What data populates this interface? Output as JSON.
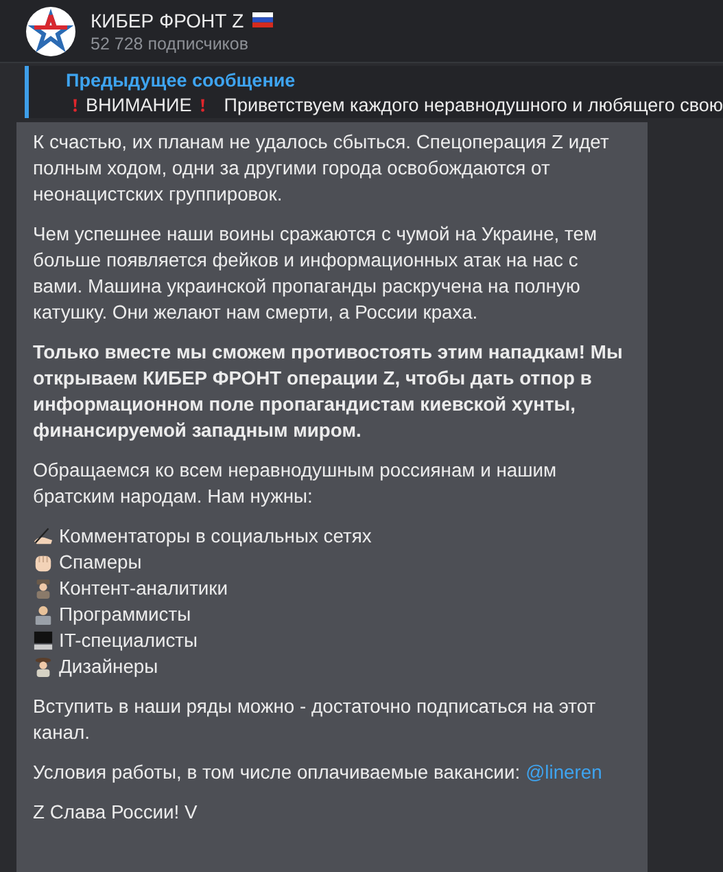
{
  "channel": {
    "title": "КИБЕР ФРОНТ Z",
    "subtitle": "52 728 подписчиков"
  },
  "reply": {
    "label": "Предыдущее сообщение",
    "prefix": "ВНИМАНИЕ",
    "text": "Приветствуем каждого неравнодушного и любящего свою"
  },
  "message": [
    {
      "kind": "text",
      "text": "К счастью, их планам не удалось сбыться. Спецоперация Z идет полным ходом, одни за другими города освобождаются от неонацистских группировок."
    },
    {
      "kind": "text",
      "text": "Чем успешнее наши воины сражаются с чумой на Украине, тем больше появляется фейков и информационных атак на нас с вами. Машина украинской пропаганды раскручена на полную катушку. Они желают нам смерти, а России краха."
    },
    {
      "kind": "bold",
      "text": "Только вместе мы сможем противостоять этим нападкам! Мы открываем КИБЕР ФРОНТ операции Z, чтобы дать отпор в информационном поле пропагандистам киевской хунты, финансируемой западным миром."
    },
    {
      "kind": "text",
      "text": "Обращаемся ко всем неравнодушным россиянам и нашим братским народам. Нам нужны:"
    },
    {
      "kind": "list",
      "items": [
        "Комментаторы в социальных сетях",
        "Спамеры",
        "Контент-аналитики",
        "Программисты",
        "IT-специалисты",
        "Дизайнеры"
      ]
    },
    {
      "kind": "text",
      "text": "Вступить в наши ряды можно - достаточно подписаться на этот канал."
    },
    {
      "kind": "link",
      "text": "Условия работы, в том числе оплачиваемые вакансии:",
      "link": "@lineren"
    },
    {
      "kind": "text",
      "text": "Z Слава России! V"
    }
  ]
}
